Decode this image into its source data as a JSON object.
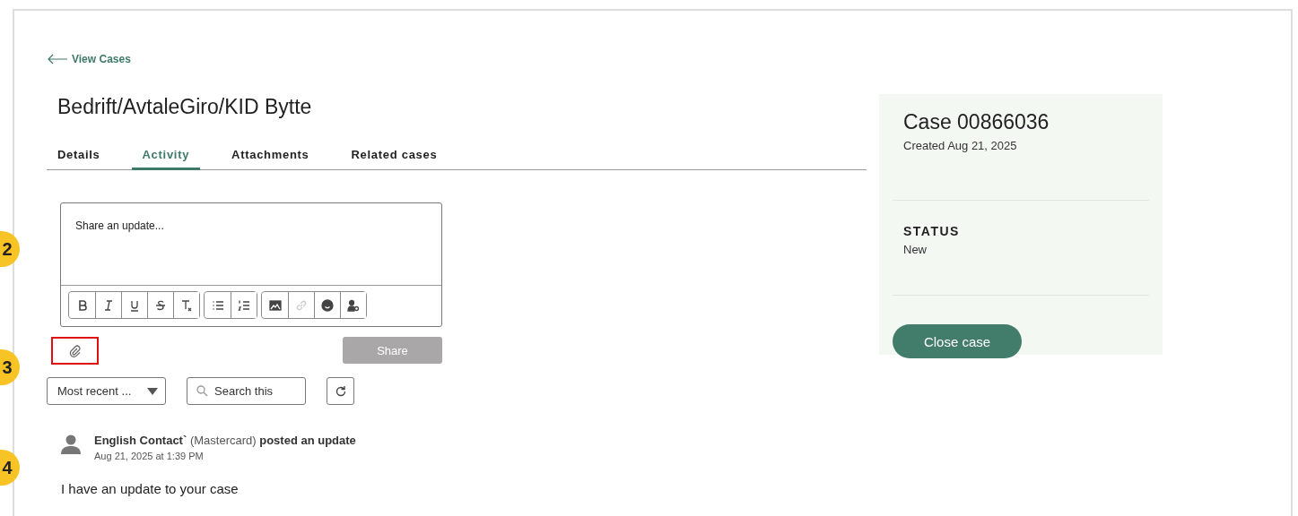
{
  "back_link": {
    "label": "View Cases"
  },
  "case_title": "Bedrift/AvtaleGiro/KID Bytte",
  "tabs": [
    {
      "label": "Details",
      "selected": false
    },
    {
      "label": "Activity",
      "selected": true
    },
    {
      "label": "Attachments",
      "selected": false
    },
    {
      "label": "Related cases",
      "selected": false
    }
  ],
  "editor": {
    "placeholder": "Share an update...",
    "toolbar_groups": [
      [
        {
          "kind": "bold",
          "disabled": false
        },
        {
          "kind": "italic",
          "disabled": false
        },
        {
          "kind": "underline",
          "disabled": false
        },
        {
          "kind": "strikethrough",
          "disabled": false
        },
        {
          "kind": "clear-format",
          "disabled": false
        }
      ],
      [
        {
          "kind": "bulleted-list",
          "disabled": false
        },
        {
          "kind": "numbered-list",
          "disabled": false
        }
      ],
      [
        {
          "kind": "image",
          "disabled": false
        },
        {
          "kind": "link",
          "disabled": true
        },
        {
          "kind": "emoji",
          "disabled": false
        },
        {
          "kind": "mention",
          "disabled": false
        }
      ]
    ]
  },
  "attach": {
    "highlighted": true
  },
  "share_button": {
    "label": "Share",
    "disabled": true
  },
  "sort_dropdown": {
    "value": "Most recent ..."
  },
  "search": {
    "placeholder": "Search this"
  },
  "post": {
    "author": "English Contact`",
    "company": "(Mastercard)",
    "action": "posted an update",
    "timestamp": "Aug 21, 2025 at 1:39 PM",
    "body": "I have an update to your case"
  },
  "case_card": {
    "number": "Case 00866036",
    "created": "Created Aug 21, 2025",
    "status_label": "STATUS",
    "status_value": "New",
    "close_button": "Close case"
  },
  "markers": [
    {
      "label": "2"
    },
    {
      "label": "3"
    },
    {
      "label": "4"
    }
  ]
}
